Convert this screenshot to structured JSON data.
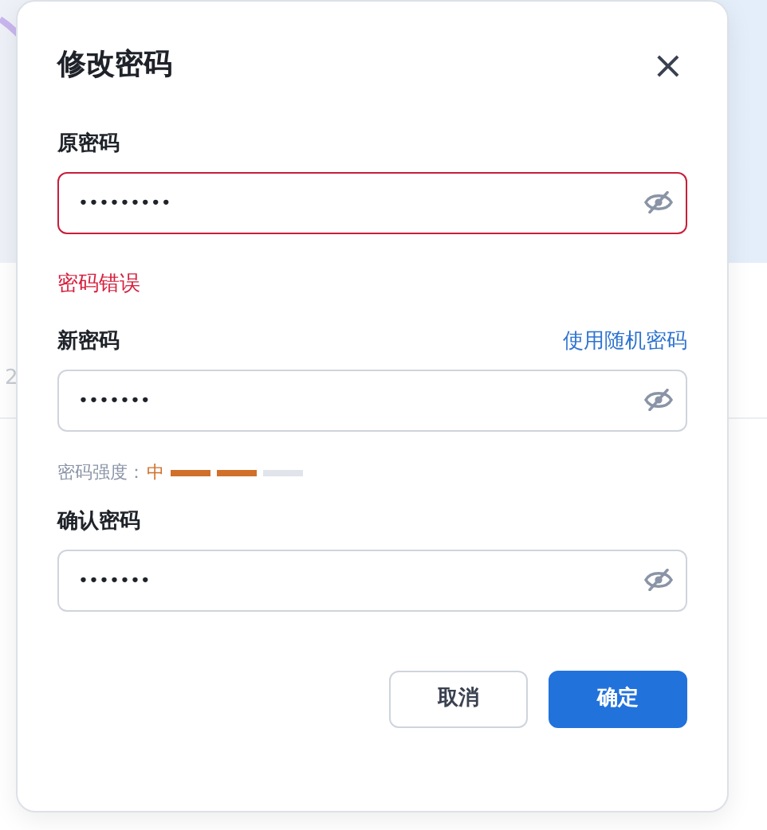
{
  "background": {
    "fragment": "2"
  },
  "dialog": {
    "title": "修改密码",
    "close": "×",
    "fields": [
      {
        "label": "原密码",
        "value": "•••••••••",
        "error": true,
        "error_message": "密码错误"
      },
      {
        "label": "新密码",
        "value": "•••••••",
        "error": false,
        "link": "使用随机密码",
        "strength": {
          "label": "密码强度：",
          "value": "中",
          "level": 0.667
        }
      },
      {
        "label": "确认密码",
        "value": "•••••••",
        "error": false
      }
    ],
    "buttons": [
      {
        "label": "取消",
        "kind": "secondary"
      },
      {
        "label": "确定",
        "kind": "primary"
      }
    ]
  }
}
